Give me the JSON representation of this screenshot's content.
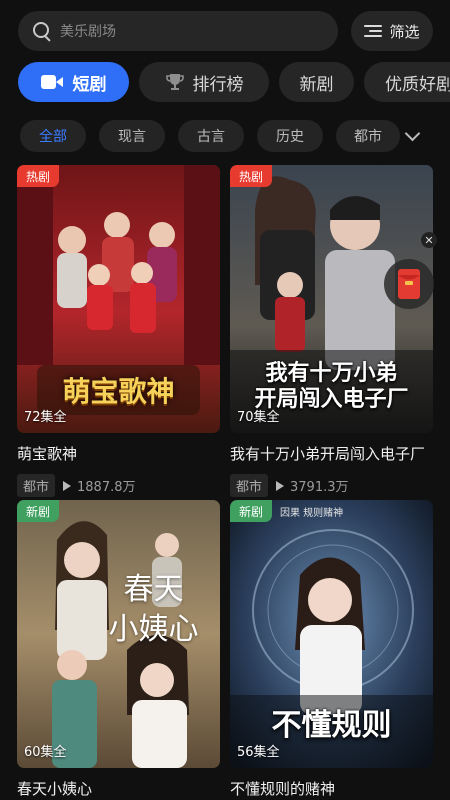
{
  "search": {
    "placeholder": "美乐剧场"
  },
  "filter": {
    "label": "筛选"
  },
  "categories": [
    {
      "label": "短剧",
      "active": true
    },
    {
      "label": "排行榜"
    },
    {
      "label": "新剧"
    },
    {
      "label": "优质好剧"
    }
  ],
  "tags": [
    {
      "label": "全部",
      "active": true
    },
    {
      "label": "现言"
    },
    {
      "label": "古言"
    },
    {
      "label": "历史"
    },
    {
      "label": "都市"
    }
  ],
  "cards": [
    {
      "badge": "热剧",
      "poster_text": "萌宝歌神",
      "episodes": "72集全",
      "title": "萌宝歌神",
      "genre": "都市",
      "plays": "1887.8万"
    },
    {
      "badge": "热剧",
      "poster_text": "我有十万小弟开局闯入电子厂",
      "poster_line1": "我有十万小弟",
      "poster_line2": "开局闯入电子厂",
      "episodes": "70集全",
      "title": "我有十万小弟开局闯入电子厂",
      "genre": "都市",
      "plays": "3791.3万"
    },
    {
      "badge": "新剧",
      "poster_text": "春天小姨心",
      "poster_line1": "春天",
      "poster_line2": "小姨心",
      "episodes": "60集全",
      "title": "春天小姨心"
    },
    {
      "badge": "新剧",
      "poster_text": "不懂规则的赌神",
      "poster_line1": "不懂规则",
      "poster_top": "因果  规则赌神",
      "episodes": "56集全",
      "title": "不懂规则的赌神"
    }
  ],
  "icons": {
    "search": "search-icon",
    "filter": "filter-icon",
    "video": "video-camera-icon",
    "trophy": "trophy-icon",
    "expand": "chevron-down-icon",
    "play": "play-icon",
    "close": "close-icon",
    "red_packet": "red-envelope-icon"
  },
  "colors": {
    "accent": "#2f6ff7",
    "hot_badge": "#e83b30",
    "new_badge": "#3fa060",
    "background": "#101010"
  }
}
